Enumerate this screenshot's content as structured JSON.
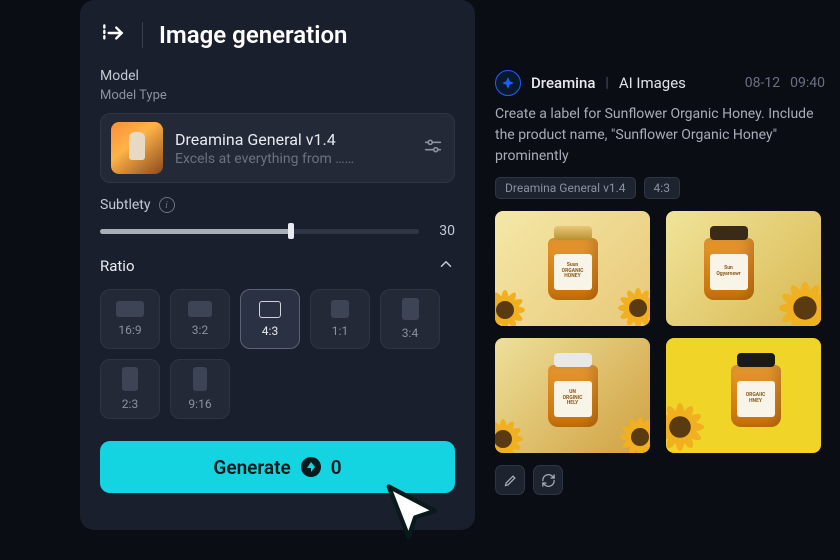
{
  "panel": {
    "title": "Image generation",
    "model_section": "Model",
    "model_type": "Model Type",
    "model_name": "Dreamina General v1.4",
    "model_desc": "Excels at everything from ……",
    "subtlety_label": "Subtlety",
    "subtlety_value": "30",
    "ratio_label": "Ratio",
    "ratios": [
      {
        "label": "16:9",
        "cls": "r169"
      },
      {
        "label": "3:2",
        "cls": "r32"
      },
      {
        "label": "4:3",
        "cls": "r43",
        "selected": true
      },
      {
        "label": "1:1",
        "cls": "r11"
      },
      {
        "label": "3:4",
        "cls": "r34"
      },
      {
        "label": "2:3",
        "cls": "r23"
      },
      {
        "label": "9:16",
        "cls": "r916"
      }
    ],
    "generate_label": "Generate",
    "generate_cost": "0"
  },
  "chat": {
    "name": "Dreamina",
    "sub": "AI Images",
    "date": "08-12",
    "time": "09:40",
    "prompt": "Create a label for Sunflower Organic Honey. Include the product name, \"Sunflower Organic Honey\" prominently",
    "tag_model": "Dreamina General v1.4",
    "tag_ratio": "4:3"
  }
}
